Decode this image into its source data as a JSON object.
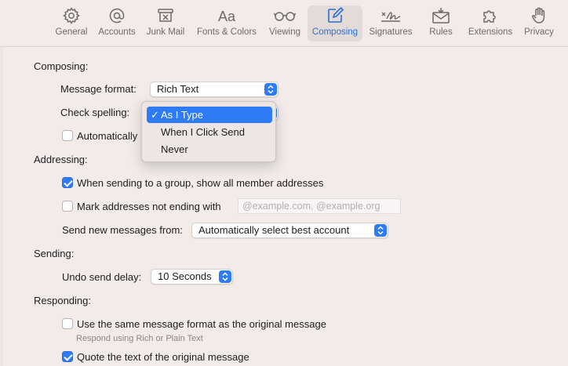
{
  "toolbar": {
    "items": [
      {
        "label": "General",
        "icon": "gear-icon"
      },
      {
        "label": "Accounts",
        "icon": "at-icon"
      },
      {
        "label": "Junk Mail",
        "icon": "junk-mail-icon"
      },
      {
        "label": "Fonts & Colors",
        "icon": "fonts-icon"
      },
      {
        "label": "Viewing",
        "icon": "glasses-icon"
      },
      {
        "label": "Composing",
        "icon": "compose-icon"
      },
      {
        "label": "Signatures",
        "icon": "signature-icon"
      },
      {
        "label": "Rules",
        "icon": "rules-icon"
      },
      {
        "label": "Extensions",
        "icon": "puzzle-icon"
      },
      {
        "label": "Privacy",
        "icon": "hand-icon"
      }
    ],
    "active": "Composing",
    "accent": "#2a6fd6"
  },
  "composing": {
    "heading": "Composing:",
    "message_format_label": "Message format:",
    "message_format_value": "Rich Text",
    "check_spelling_label": "Check spelling:",
    "automatically_label": "Automatically",
    "spelling_menu": {
      "options": [
        "As I Type",
        "When I Click Send",
        "Never"
      ],
      "selected": "As I Type",
      "check_glyph": "✓"
    }
  },
  "addressing": {
    "heading": "Addressing:",
    "show_all_members": {
      "label": "When sending to a group, show all member addresses",
      "checked": true
    },
    "mark_addresses": {
      "label": "Mark addresses not ending with",
      "checked": false
    },
    "domains_placeholder": "@example.com, @example.org",
    "send_from_label": "Send new messages from:",
    "send_from_value": "Automatically select best account"
  },
  "sending": {
    "heading": "Sending:",
    "undo_label": "Undo send delay:",
    "undo_value": "10 Seconds"
  },
  "responding": {
    "heading": "Responding:",
    "same_format": {
      "label": "Use the same message format as the original message",
      "checked": false
    },
    "same_format_hint": "Respond using Rich or Plain Text",
    "quote_text": {
      "label": "Quote the text of the original message",
      "checked": true
    }
  }
}
